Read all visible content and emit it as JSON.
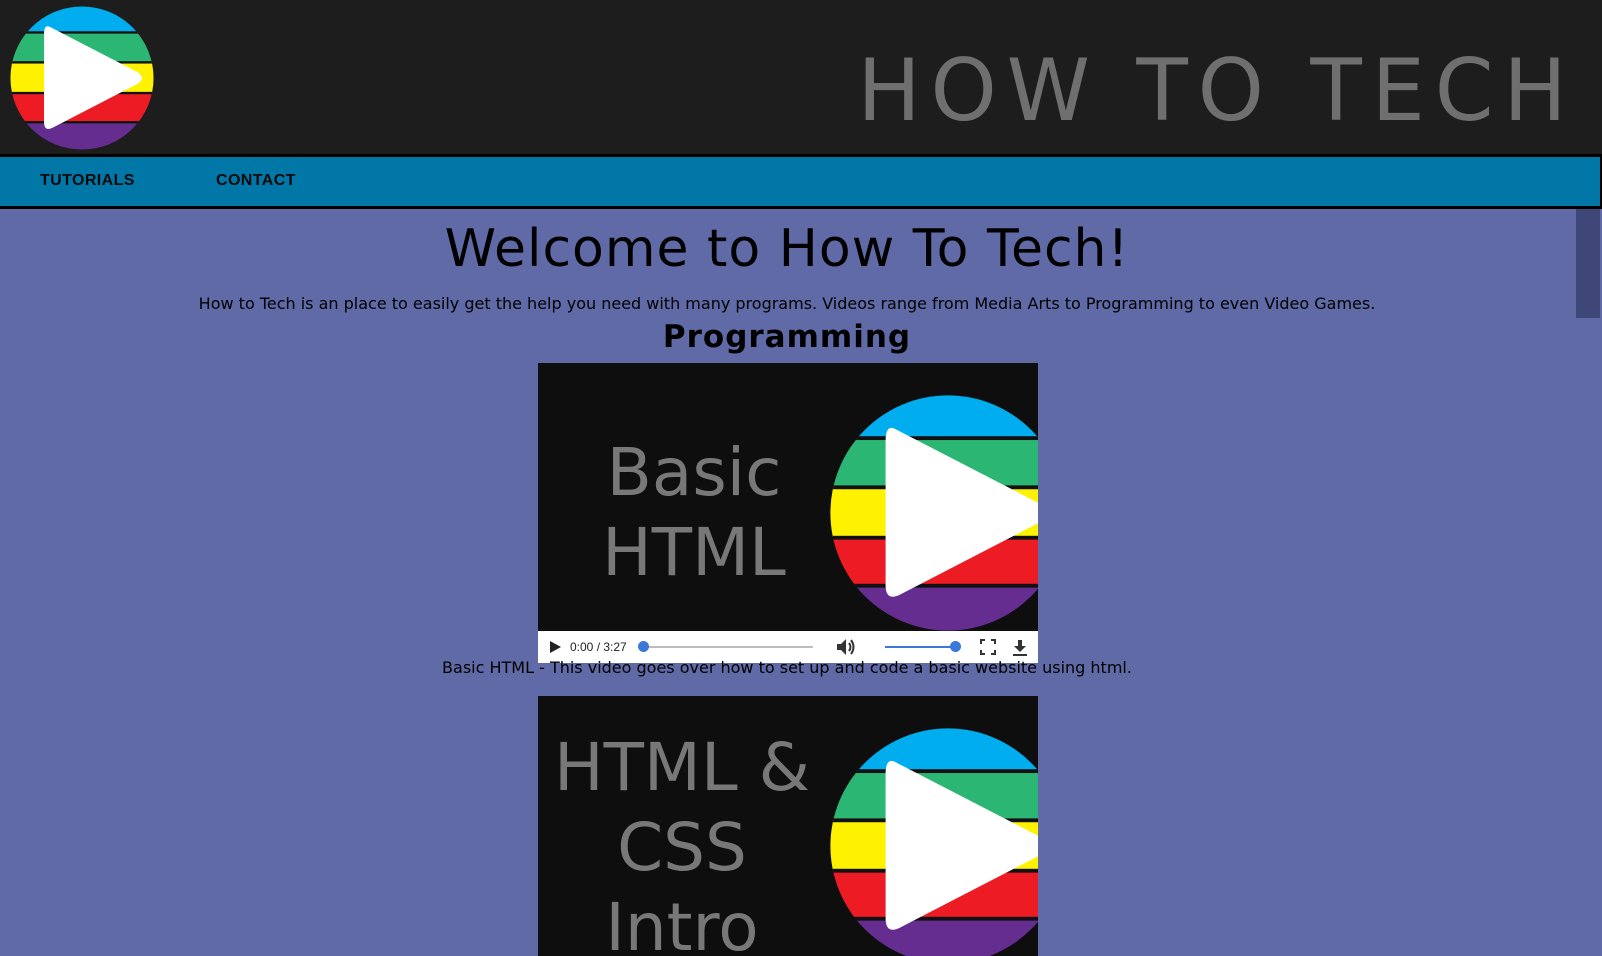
{
  "header": {
    "brand": "HOW TO TECH"
  },
  "nav": {
    "items": [
      {
        "label": "TUTORIALS"
      },
      {
        "label": "CONTACT"
      }
    ]
  },
  "main": {
    "title": "Welcome to How To Tech!",
    "intro": "How to Tech is an place to easily get the help you need with many programs. Videos range from Media Arts to Programming to even Video Games.",
    "section": "Programming",
    "videos": [
      {
        "thumb_lines": [
          "Basic",
          "HTML"
        ],
        "time": "0:00 / 3:27",
        "progress": 0.0,
        "volume": 1.0,
        "caption": "Basic HTML - This video goes over how to set up and code a basic website using html."
      },
      {
        "thumb_lines": [
          "HTML &",
          "CSS",
          "Intro"
        ]
      }
    ]
  },
  "colors": {
    "page_bg": "#606aa6",
    "header_bg": "#1d1d1d",
    "nav_bg": "#0077a7",
    "logo_stripes": [
      "#00aeef",
      "#2bb673",
      "#fff200",
      "#ed1c24",
      "#662d91"
    ]
  }
}
